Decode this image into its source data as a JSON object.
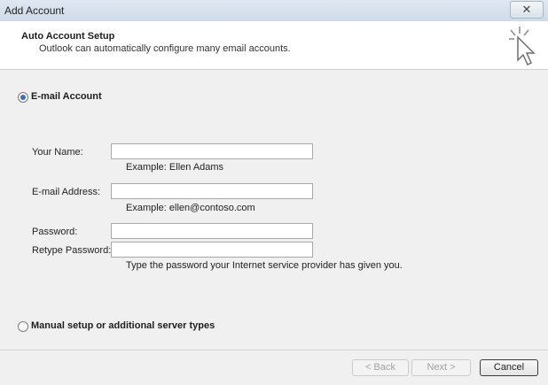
{
  "window": {
    "title": "Add Account",
    "close_glyph": "✕"
  },
  "header": {
    "title": "Auto Account Setup",
    "subtitle": "Outlook can automatically configure many email accounts."
  },
  "email_account": {
    "option_label": "E-mail Account",
    "selected": true,
    "fields": {
      "name": {
        "label": "Your Name:",
        "value": "",
        "hint": "Example: Ellen Adams"
      },
      "email": {
        "label": "E-mail Address:",
        "value": "",
        "hint": "Example: ellen@contoso.com"
      },
      "password": {
        "label": "Password:",
        "value": ""
      },
      "retype_password": {
        "label": "Retype Password:",
        "value": ""
      }
    },
    "password_hint": "Type the password your Internet service provider has given you."
  },
  "manual_setup": {
    "option_label": "Manual setup or additional server types",
    "selected": false
  },
  "buttons": {
    "back": "< Back",
    "next": "Next >",
    "cancel": "Cancel"
  },
  "colors": {
    "accent": "#3c6fb3",
    "titlebar": "#cfdbe9"
  }
}
